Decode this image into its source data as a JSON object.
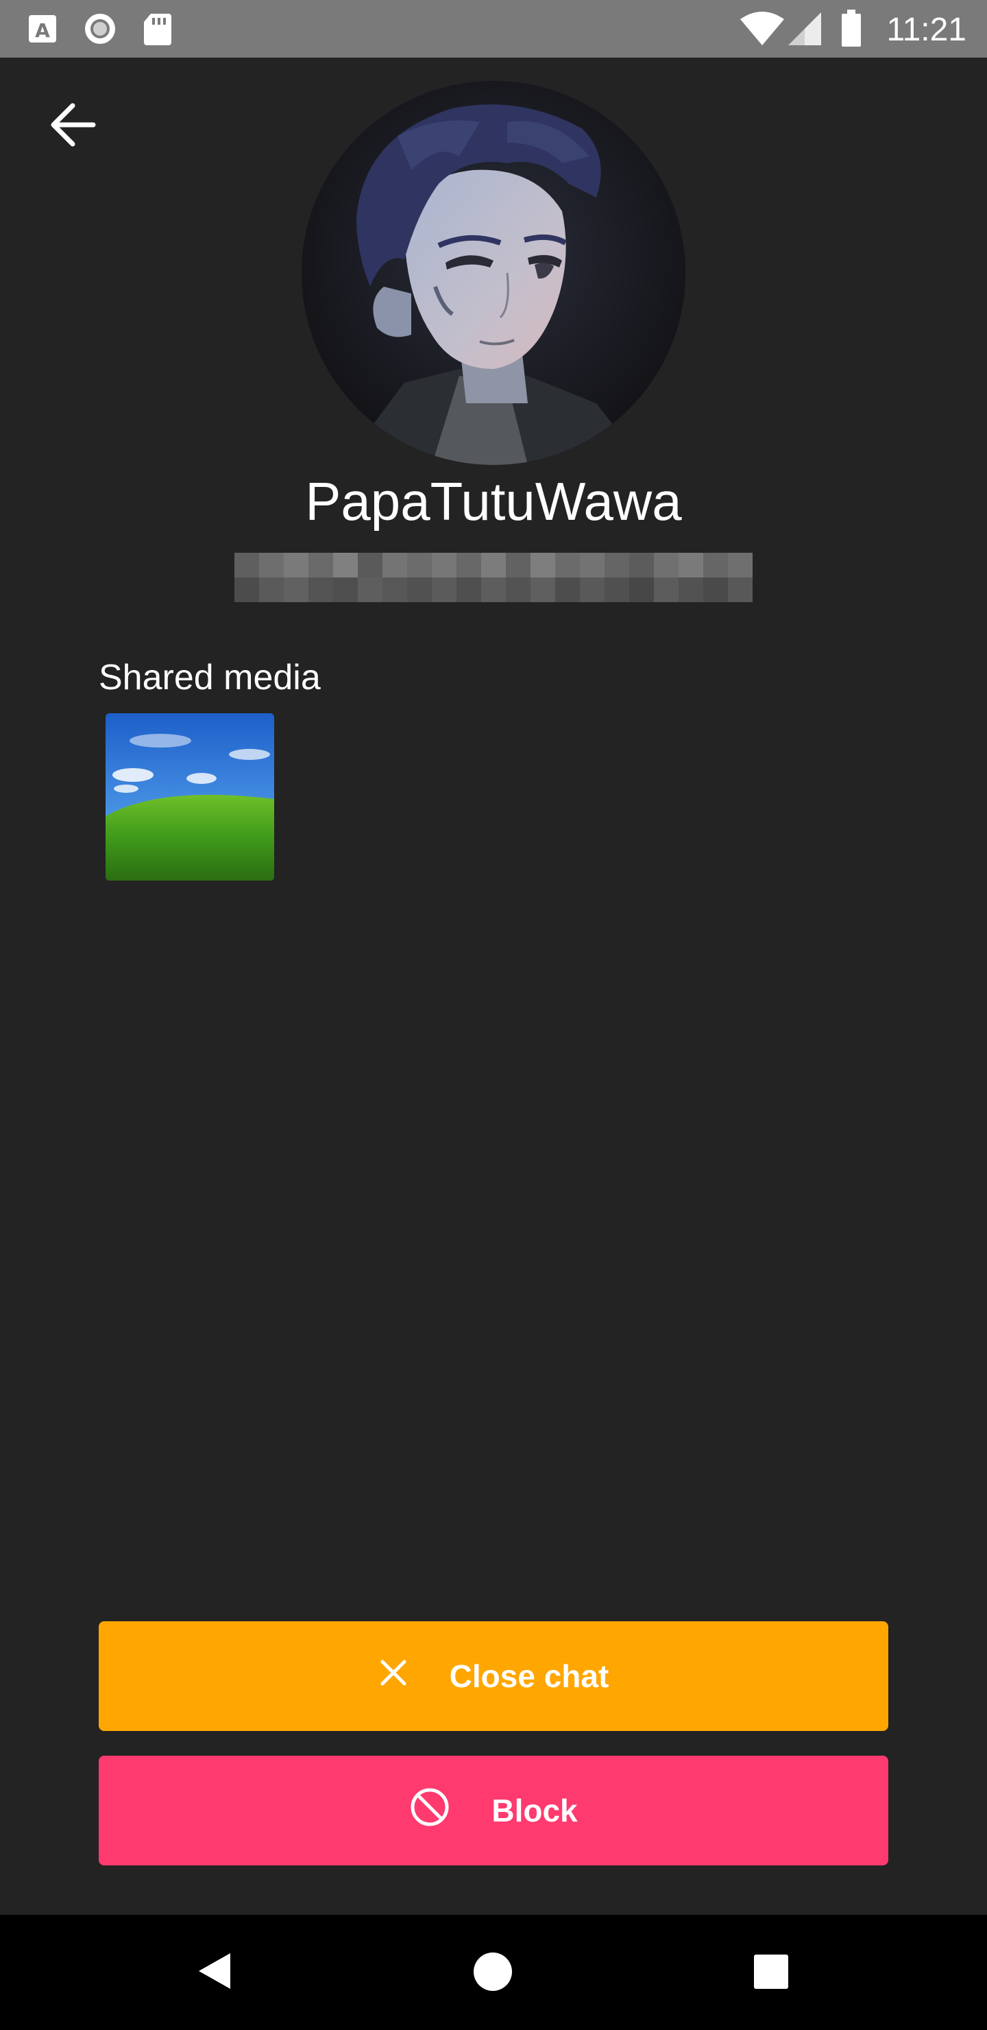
{
  "status_bar": {
    "time": "11:21",
    "icons": [
      "text-a-icon",
      "circle-sync-icon",
      "sd-card-icon",
      "wifi-icon",
      "signal-icon",
      "battery-icon"
    ]
  },
  "header": {
    "back_icon": "arrow-left-icon"
  },
  "profile": {
    "username": "PapaTutuWawa"
  },
  "shared_media": {
    "title": "Shared media"
  },
  "actions": {
    "close_chat_label": "Close chat",
    "close_chat_icon": "close-icon",
    "block_label": "Block",
    "block_icon": "block-icon"
  },
  "colors": {
    "background": "#232323",
    "status_bar": "#7a7a7a",
    "close_chat": "#ffa600",
    "block": "#ff3a6e",
    "nav_bar": "#000000"
  },
  "nav_bar": {
    "icons": [
      "back-triangle-icon",
      "home-circle-icon",
      "recents-square-icon"
    ]
  }
}
